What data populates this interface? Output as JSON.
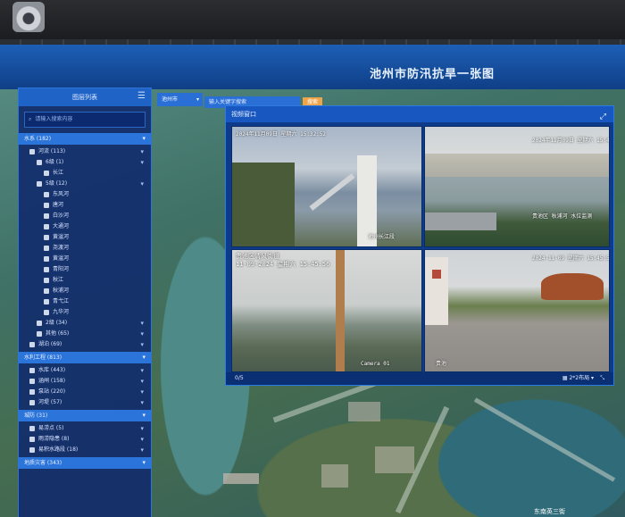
{
  "app": {
    "title": "池州市防汛抗旱一张图"
  },
  "toolbar": {
    "city_value": "池州市",
    "keyword_placeholder": "输入关键字搜索",
    "search_label": "搜索"
  },
  "layer_panel": {
    "title": "图层列表",
    "search_placeholder": "请输入搜索内容",
    "groups": [
      {
        "label": "水系 (182)",
        "rows": [
          {
            "label": "河流 (113)",
            "level": 1,
            "chev": true
          },
          {
            "label": "6级 (1)",
            "level": 2,
            "chev": true
          },
          {
            "label": "长江",
            "level": 3,
            "chev": false
          },
          {
            "label": "5级 (12)",
            "level": 2,
            "chev": true
          },
          {
            "label": "东风河",
            "level": 3,
            "chev": false
          },
          {
            "label": "唐河",
            "level": 3,
            "chev": false
          },
          {
            "label": "白沙河",
            "level": 3,
            "chev": false
          },
          {
            "label": "大通河",
            "level": 3,
            "chev": false
          },
          {
            "label": "黄湓河",
            "level": 3,
            "chev": false
          },
          {
            "label": "尧渡河",
            "level": 3,
            "chev": false
          },
          {
            "label": "黄湓河",
            "level": 3,
            "chev": false
          },
          {
            "label": "青阳河",
            "level": 3,
            "chev": false
          },
          {
            "label": "秋江",
            "level": 3,
            "chev": false
          },
          {
            "label": "秋浦河",
            "level": 3,
            "chev": false
          },
          {
            "label": "青弋江",
            "level": 3,
            "chev": false
          },
          {
            "label": "九华河",
            "level": 3,
            "chev": false
          },
          {
            "label": "2级 (34)",
            "level": 2,
            "chev": true
          },
          {
            "label": "其他 (65)",
            "level": 2,
            "chev": true
          },
          {
            "label": "湖泊 (69)",
            "level": 1,
            "chev": true
          }
        ]
      },
      {
        "label": "水利工程 (813)",
        "rows": [
          {
            "label": "水库 (443)",
            "level": 1,
            "chev": true
          },
          {
            "label": "涵闸 (158)",
            "level": 1,
            "chev": true
          },
          {
            "label": "泵站 (220)",
            "level": 1,
            "chev": true
          },
          {
            "label": "河堤 (57)",
            "level": 1,
            "chev": true
          }
        ]
      },
      {
        "label": "城防 (31)",
        "rows": [
          {
            "label": "易涝点 (5)",
            "level": 1,
            "chev": true
          },
          {
            "label": "雨涝隐患 (8)",
            "level": 1,
            "chev": true
          },
          {
            "label": "易积水路段 (18)",
            "level": 1,
            "chev": true
          }
        ]
      },
      {
        "label": "地质灾害 (343)",
        "rows": []
      }
    ]
  },
  "video_window": {
    "title": "视频窗口",
    "footer_left": "0/5",
    "layout_label": "2*2布局",
    "tiles": [
      {
        "timestamp": "2024年11月09日 星期六 15:32:52",
        "caption": "池州长江段"
      },
      {
        "timestamp": "2024年11月09日 星期六 15:45:53",
        "caption": "贵池区  秋浦河  水位监测"
      },
      {
        "timestamp": "11-09-2024 星期六 15:45:56",
        "header": "贵池区清风街道",
        "caption": "Camera 01"
      },
      {
        "timestamp": "2024-11-09 星期六 15:45:56",
        "caption": "贵池"
      }
    ]
  },
  "map": {
    "label_bottom": "东南英三街"
  }
}
